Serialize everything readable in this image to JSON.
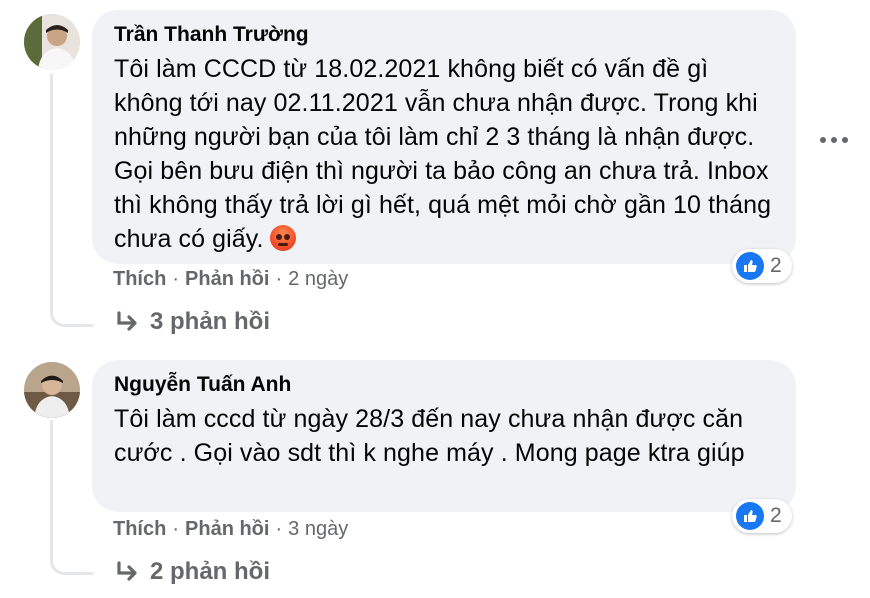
{
  "comments": [
    {
      "author": "Trần Thanh Trường",
      "text": "Tôi làm CCCD từ 18.02.2021 không biết có vấn đề gì không tới nay 02.11.2021 vẫn chưa nhận được. Trong khi những người bạn của tôi làm chỉ 2 3 tháng là nhận được. Gọi bên bưu điện thì người ta bảo công an chưa trả. Inbox thì không thấy trả lời gì hết, quá mệt mỏi chờ gần 10 tháng chưa có giấy.",
      "emoji": "angry-face",
      "like_label": "Thích",
      "reply_label": "Phản hồi",
      "time": "2 ngày",
      "reaction_count": "2",
      "replies_label": "3 phản hồi"
    },
    {
      "author": "Nguyễn Tuấn Anh",
      "text": "Tôi làm cccd từ ngày 28/3 đến nay chưa nhận được căn cước . Gọi vào sdt thì k nghe máy . Mong page ktra giúp",
      "like_label": "Thích",
      "reply_label": "Phản hồi",
      "time": "3 ngày",
      "reaction_count": "2",
      "replies_label": "2 phản hồi"
    }
  ],
  "icons": {
    "more": "more-options-icon",
    "like": "like-reaction-icon",
    "reply_arrow": "reply-arrow-icon"
  },
  "colors": {
    "bubble": "#f0f2f5",
    "secondary_text": "#65676b",
    "like_blue": "#1877f2",
    "thread_line": "#e4e6eb"
  }
}
